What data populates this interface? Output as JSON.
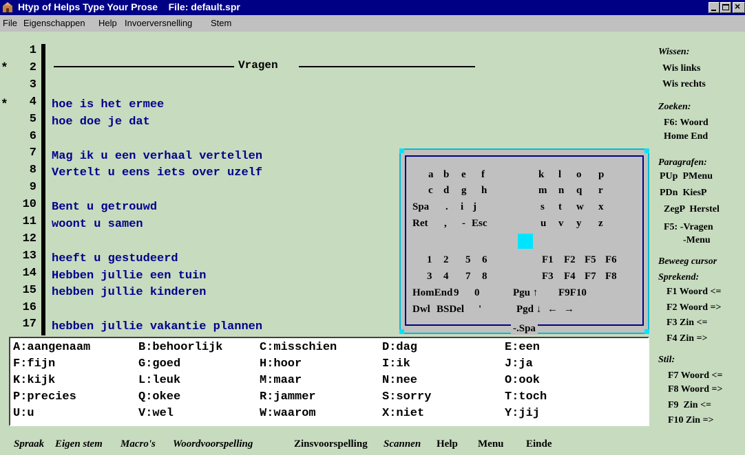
{
  "window": {
    "title": "Htyp of Helps Type Your Prose    File: default.spr",
    "colors": {
      "titlebar": "#000084",
      "background": "#c7dbbf",
      "text_blue": "#00008b",
      "cyan": "#00e5ff"
    }
  },
  "menu": [
    "File",
    "Eigenschappen",
    "Help",
    "Invoerversnelling",
    "Stem"
  ],
  "editor": {
    "line_numbers": [
      "1",
      "2",
      "3",
      "4",
      "5",
      "6",
      "7",
      "8",
      "9",
      "10",
      "11",
      "12",
      "13",
      "14",
      "15",
      "16",
      "17"
    ],
    "stars": [
      "*",
      "*"
    ],
    "heading": "Vragen",
    "lines": [
      "hoe is het ermee",
      "hoe doe je dat",
      "Mag ik u een verhaal vertellen",
      "Vertelt u eens iets over uzelf",
      "Bent u getrouwd",
      "woont u samen",
      "heeft u gestudeerd",
      "Hebben jullie een tuin",
      "hebben jullie kinderen",
      "hebben jullie vakantie plannen"
    ]
  },
  "keyboard": {
    "rows": [
      [
        "a",
        "b",
        "e",
        "f",
        "k",
        "l",
        "o",
        "p"
      ],
      [
        "c",
        "d",
        "g",
        "h",
        "m",
        "n",
        "q",
        "r"
      ],
      [
        "Spa",
        ".",
        "i",
        "j",
        "s",
        "t",
        "w",
        "x"
      ],
      [
        "Ret",
        ",",
        "-",
        "Esc",
        "u",
        "v",
        "y",
        "z"
      ],
      [
        "1",
        "2",
        "5",
        "6",
        "F1",
        "F2",
        "F5",
        "F6"
      ],
      [
        "3",
        "4",
        "7",
        "8",
        "F3",
        "F4",
        "F7",
        "F8"
      ],
      [
        "HomEnd",
        "9",
        "0",
        "Pgu ↑",
        "F9F10"
      ],
      [
        "Dwl",
        "BSDel",
        "'",
        "Pgd ↓",
        "←",
        "→"
      ]
    ],
    "bottom_label": "-.Spa"
  },
  "shortcuts": [
    [
      "A:aangenaam",
      "B:behoorlijk",
      "C:misschien",
      "D:dag",
      "E:een"
    ],
    [
      "F:fijn",
      "G:goed",
      "H:hoor",
      "I:ik",
      "J:ja"
    ],
    [
      "K:kijk",
      "L:leuk",
      "M:maar",
      "N:nee",
      "O:ook"
    ],
    [
      "P:precies",
      "Q:okee",
      "R:jammer",
      "S:sorry",
      "T:toch"
    ],
    [
      "U:u",
      "V:wel",
      "W:waarom",
      "X:niet",
      "Y:jij"
    ]
  ],
  "right_panel": {
    "wissen": {
      "header": "Wissen:",
      "items": [
        "Wis links",
        "Wis rechts"
      ]
    },
    "zoeken": {
      "header": "Zoeken:",
      "items": [
        "F6: Woord",
        "Home End"
      ]
    },
    "paragrafen": {
      "header": "Paragrafen:",
      "items": [
        "PUp  PMenu",
        "PDn  KiesP",
        "ZegP  Herstel",
        "F5: -Vragen",
        "-Menu"
      ]
    },
    "beweeg": {
      "header": "Beweeg cursor"
    },
    "sprekend": {
      "header": "Sprekend:",
      "items": [
        "F1 Woord <=",
        "F2 Woord =>",
        "F3 Zin <=",
        "F4 Zin =>"
      ]
    },
    "stil": {
      "header": "Stil:",
      "items": [
        "F7 Woord <=",
        "F8 Woord =>",
        "F9  Zin <=",
        "F10 Zin =>"
      ]
    }
  },
  "bottom_bar": [
    "Spraak",
    "Eigen stem",
    "Macro's",
    "Woordvoorspelling",
    "Zinsvoorspelling",
    "Scannen",
    "Help",
    "Menu",
    "Einde"
  ]
}
